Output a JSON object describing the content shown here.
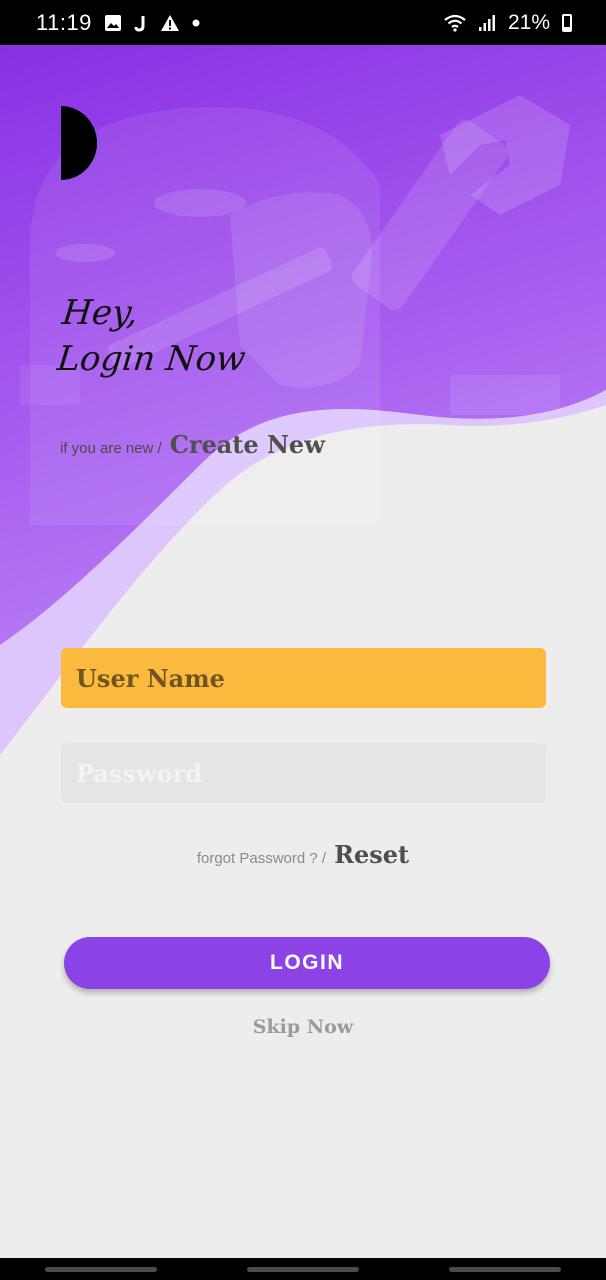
{
  "status_bar": {
    "time": "11:19",
    "battery": "21%",
    "icons": [
      "image-icon",
      "j-app-icon",
      "warning-icon",
      "dot-icon",
      "wifi-icon",
      "signal-icon",
      "battery-icon"
    ]
  },
  "colors": {
    "hero_purple": "#8d34e6",
    "wave_light": "#dcc6fc",
    "field_username": "#fbb93e",
    "field_password": "#e6e4e5",
    "login_button": "#8c43e6",
    "background": "#ededed"
  },
  "greeting": {
    "line1": "Hey,",
    "line2": "Login Now"
  },
  "signup": {
    "prefix": "if you are new /",
    "link": "Create New"
  },
  "form": {
    "username_placeholder": "User Name",
    "password_placeholder": "Password"
  },
  "forgot": {
    "prefix": "forgot Password ? /",
    "link": "Reset"
  },
  "login_button": "LOGIN",
  "skip": "Skip Now"
}
